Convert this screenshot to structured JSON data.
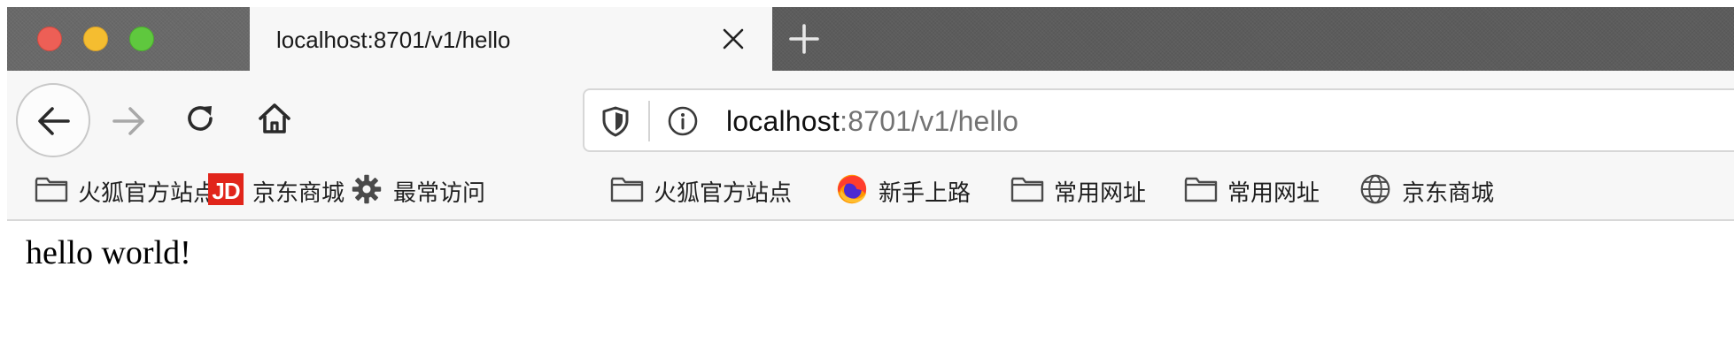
{
  "window": {
    "traffic_lights": {
      "close_color": "#ed5f56",
      "minimize_color": "#f5bd30",
      "maximize_color": "#5fc83e"
    }
  },
  "tab": {
    "title": "localhost:8701/v1/hello",
    "close_icon": "close-icon",
    "new_tab_icon": "plus-icon"
  },
  "nav": {
    "back_icon": "arrow-left-icon",
    "forward_icon": "arrow-right-icon",
    "reload_icon": "reload-icon",
    "home_icon": "home-icon"
  },
  "urlbar": {
    "security_icon": "shield-icon",
    "info_icon": "info-icon",
    "host": "localhost",
    "rest": ":8701/v1/hello"
  },
  "bookmarks": [
    {
      "label": "火狐官方站点",
      "icon": "folder-icon"
    },
    {
      "label": "京东商城",
      "icon": "jd-icon",
      "icon_text": "JD",
      "icon_color": "#e1251b"
    },
    {
      "label": "最常访问",
      "icon": "gear-icon"
    },
    {
      "label": "火狐官方站点",
      "icon": "folder-icon"
    },
    {
      "label": "新手上路",
      "icon": "firefox-icon"
    },
    {
      "label": "常用网址",
      "icon": "folder-icon"
    },
    {
      "label": "常用网址",
      "icon": "folder-icon"
    },
    {
      "label": "京东商城",
      "icon": "globe-icon"
    }
  ],
  "content": {
    "text": "hello world!"
  }
}
